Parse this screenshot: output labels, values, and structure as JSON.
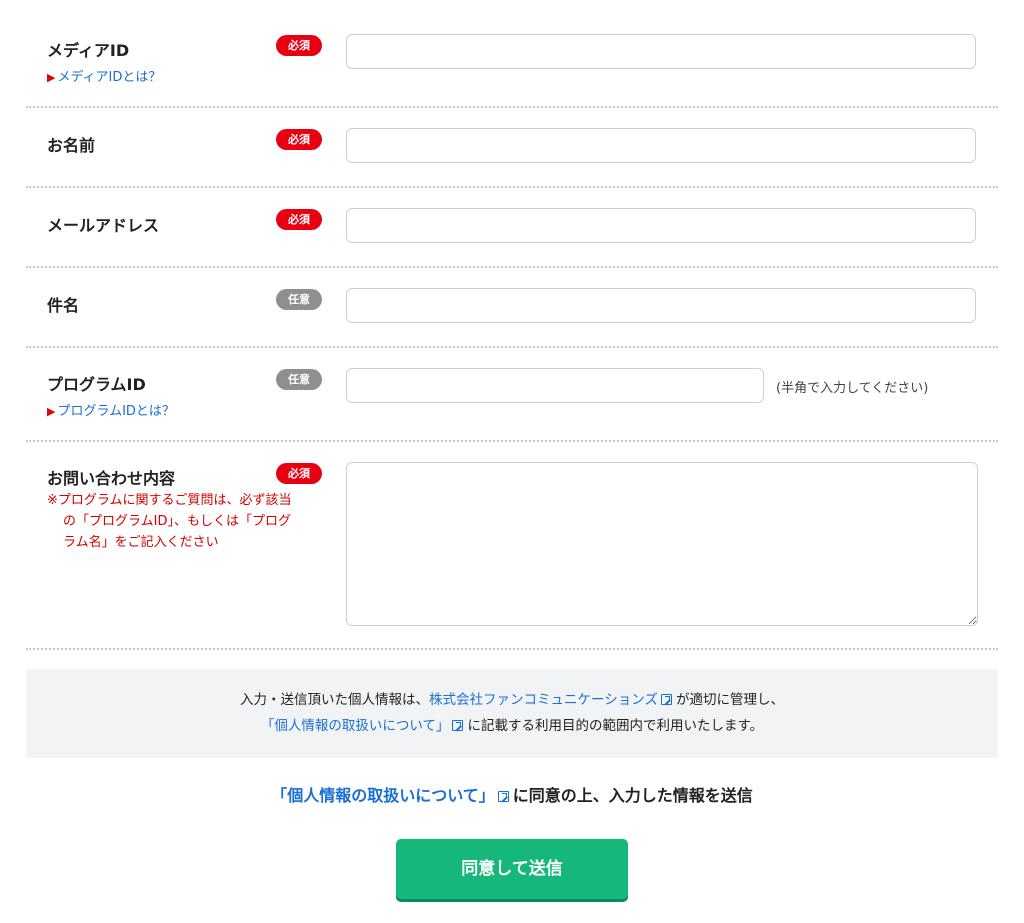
{
  "fields": {
    "media_id": {
      "label": "メディアID",
      "badge": "必須",
      "help_link": "メディアIDとは？",
      "value": ""
    },
    "name": {
      "label": "お名前",
      "badge": "必須",
      "value": ""
    },
    "email": {
      "label": "メールアドレス",
      "badge": "必須",
      "value": ""
    },
    "subject": {
      "label": "件名",
      "badge": "任意",
      "value": ""
    },
    "program_id": {
      "label": "プログラムID",
      "badge": "任意",
      "help_link": "プログラムIDとは？",
      "hint": "(半角で入力してください)",
      "value": ""
    },
    "inquiry": {
      "label": "お問い合わせ内容",
      "badge": "必須",
      "note_line1": "※プログラムに関するご質問は、必ず該当",
      "note_line2": "の「プログラムID」、もしくは「プログ",
      "note_line3": "ラム名」をご記入ください",
      "value": ""
    }
  },
  "privacy": {
    "line1_prefix": "入力・送信頂いた個人情報は、",
    "company_link": "株式会社ファンコミュニケーションズ",
    "line1_suffix": "が適切に管理し、",
    "policy_link": "「個人情報の取扱いについて」",
    "line2_suffix": "に記載する利用目的の範囲内で利用いたします。"
  },
  "consent": {
    "policy_link": "「個人情報の取扱いについて」",
    "text": "に同意の上、入力した情報を送信"
  },
  "submit_label": "同意して送信",
  "colors": {
    "required_badge": "#e60012",
    "optional_badge": "#8f8f8f",
    "link": "#1a6fd6",
    "note_text": "#d40000",
    "submit_button": "#16b77a"
  }
}
